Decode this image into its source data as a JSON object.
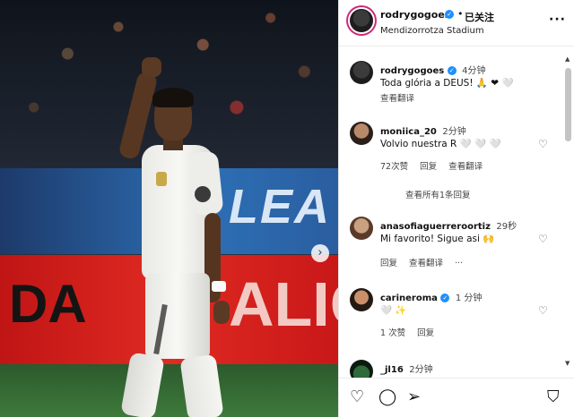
{
  "photo": {
    "board_blue_text": "LEA",
    "board_red_left_text": "DA",
    "board_red_right_text": "ALIC",
    "next_icon": "chevron-right-icon"
  },
  "header": {
    "username": "rodrygogoes",
    "dot": "•",
    "follow_label": "已关注",
    "location": "Mendizorrotza Stadium",
    "more_label": "···"
  },
  "post": {
    "username": "rodrygogoes",
    "time": "4分钟",
    "caption": "Toda glória a DEUS! 🙏 ❤ 🤍",
    "translate_label": "查看翻译"
  },
  "comments": [
    {
      "username": "moniica_20",
      "time": "2分钟",
      "text": "Volvio nuestra R 🤍 🤍 🤍",
      "likes": "72次赞",
      "reply": "回复",
      "translate": "查看翻译"
    },
    {
      "view_replies": "查看所有1条回复"
    },
    {
      "username": "anasofiaguerreroortiz",
      "time": "29秒",
      "text": "Mi favorito! Sigue asi 🙌",
      "reply": "回复",
      "translate": "查看翻译",
      "more": "···"
    },
    {
      "username": "carineroma",
      "time": "1 分钟",
      "text": "🤍 ✨",
      "likes": "1 次赞",
      "reply": "回复"
    },
    {
      "username": "_jl16",
      "time": "2分钟"
    }
  ],
  "footer": {
    "icons": [
      "heart-icon",
      "comment-icon",
      "share-icon",
      "bookmark-icon"
    ]
  }
}
